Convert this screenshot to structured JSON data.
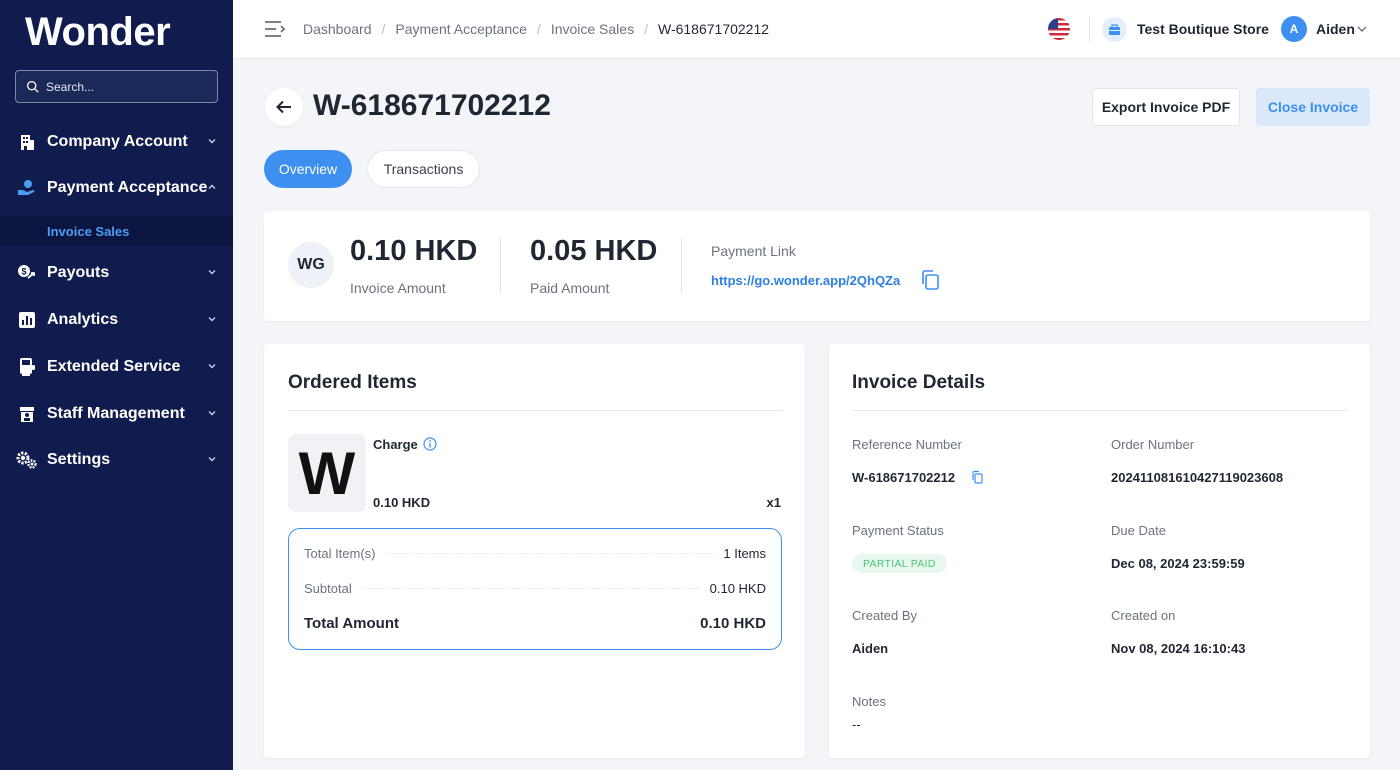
{
  "brand": {
    "logo_text": "Wonder",
    "accent": "#3d8ff0",
    "sidebar_bg": "#0f1c4d"
  },
  "sidebar": {
    "search_placeholder": "Search...",
    "items": [
      {
        "label": "Company Account",
        "icon": "building-icon"
      },
      {
        "label": "Payment Acceptance",
        "icon": "hand-coin-icon",
        "expanded": true,
        "sub_items": [
          {
            "label": "Invoice Sales",
            "active": true
          }
        ]
      },
      {
        "label": "Payouts",
        "icon": "payout-icon"
      },
      {
        "label": "Analytics",
        "icon": "bar-chart-icon"
      },
      {
        "label": "Extended Service",
        "icon": "terminal-icon"
      },
      {
        "label": "Staff Management",
        "icon": "store-staff-icon"
      },
      {
        "label": "Settings",
        "icon": "gears-icon"
      }
    ]
  },
  "topbar": {
    "breadcrumbs": [
      "Dashboard",
      "Payment Acceptance",
      "Invoice Sales",
      "W-618671702212"
    ],
    "store_name": "Test Boutique Store",
    "user_initial": "A",
    "user_name": "Aiden"
  },
  "header": {
    "title": "W-618671702212",
    "export_label": "Export Invoice PDF",
    "close_label": "Close Invoice"
  },
  "tabs": [
    {
      "label": "Overview",
      "active": true
    },
    {
      "label": "Transactions",
      "active": false
    }
  ],
  "summary": {
    "merchant_initials": "WG",
    "invoice_amount": "0.10 HKD",
    "invoice_amount_label": "Invoice Amount",
    "paid_amount": "0.05 HKD",
    "paid_amount_label": "Paid Amount",
    "payment_link_label": "Payment Link",
    "payment_link": "https://go.wonder.app/2QhQZa"
  },
  "ordered_items": {
    "title": "Ordered Items",
    "items": [
      {
        "thumb": "W",
        "name": "Charge",
        "price": "0.10 HKD",
        "qty": "x1"
      }
    ],
    "totals": {
      "total_items_label": "Total Item(s)",
      "total_items_value": "1 Items",
      "subtotal_label": "Subtotal",
      "subtotal_value": "0.10 HKD",
      "total_amount_label": "Total Amount",
      "total_amount_value": "0.10 HKD"
    }
  },
  "invoice_details": {
    "title": "Invoice Details",
    "reference_label": "Reference Number",
    "reference_value": "W-618671702212",
    "order_label": "Order Number",
    "order_value": "20241108161042711902360 8",
    "status_label": "Payment Status",
    "status_value": "PARTIAL PAID",
    "status_color": "#4fc37a",
    "due_label": "Due Date",
    "due_value": "Dec 08, 2024 23:59:59",
    "created_by_label": "Created By",
    "created_by_value": "Aiden",
    "created_on_label": "Created on",
    "created_on_value": "Nov 08, 2024 16:10:43",
    "notes_label": "Notes",
    "notes_value": "--"
  }
}
